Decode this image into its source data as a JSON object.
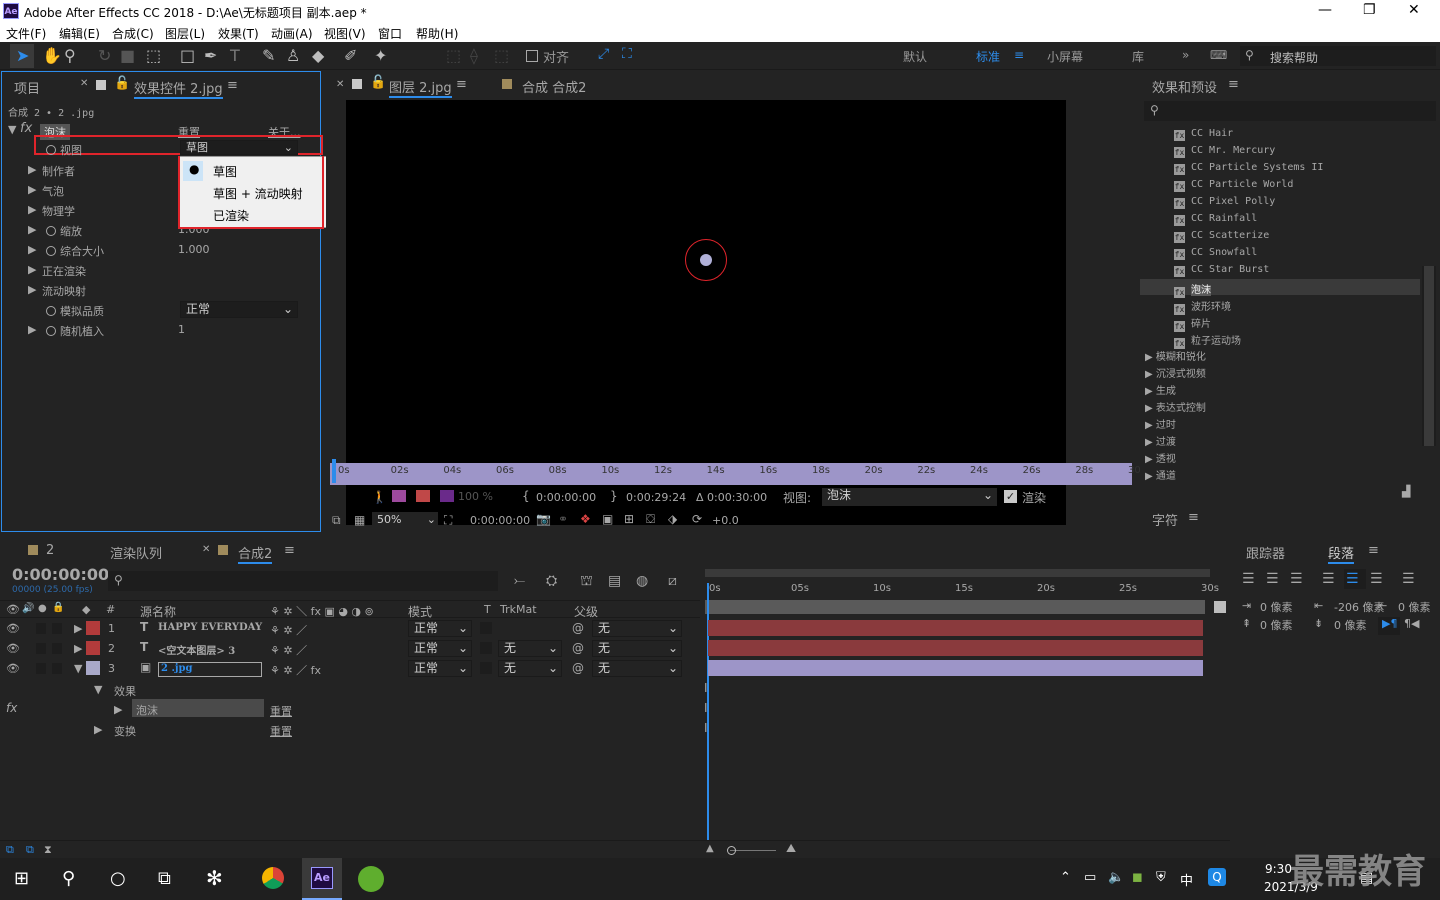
{
  "window": {
    "title": "Adobe After Effects CC 2018 - D:\\Ae\\无标题项目 副本.aep *",
    "logo": "Ae"
  },
  "menu": [
    "文件(F)",
    "编辑(E)",
    "合成(C)",
    "图层(L)",
    "效果(T)",
    "动画(A)",
    "视图(V)",
    "窗口",
    "帮助(H)"
  ],
  "toolbar": {
    "snap": "对齐",
    "workspaces": [
      "默认",
      "标准",
      "小屏幕",
      "库"
    ],
    "active_workspace": "标准",
    "search_placeholder": "搜索帮助"
  },
  "left_panel": {
    "tab_project": "项目",
    "tab_effects": "效果控件 2.jpg",
    "subtitle": "合成 2 • 2 .jpg",
    "effect_name": "泡沫",
    "reset": "重置",
    "about": "关于...",
    "props": [
      {
        "label": "视图",
        "value": "草图",
        "stopwatch": true
      },
      {
        "label": "制作者",
        "value": ""
      },
      {
        "label": "气泡",
        "value": ""
      },
      {
        "label": "物理学",
        "value": ""
      },
      {
        "label": "缩放",
        "value": "1.000",
        "stopwatch": true
      },
      {
        "label": "综合大小",
        "value": "1.000",
        "stopwatch": true
      },
      {
        "label": "正在渲染",
        "value": ""
      },
      {
        "label": "流动映射",
        "value": ""
      },
      {
        "label": "模拟品质",
        "value": "正常",
        "stopwatch": true
      },
      {
        "label": "随机植入",
        "value": "1",
        "stopwatch": true
      }
    ],
    "dropdown_options": [
      "草图",
      "草图 + 流动映射",
      "已渲染"
    ],
    "dropdown_selected": "草图"
  },
  "viewer": {
    "tab_layer": "图层 2.jpg",
    "tab_comp": "合成 合成2",
    "ruler": [
      "0s",
      "02s",
      "04s",
      "06s",
      "08s",
      "10s",
      "12s",
      "14s",
      "16s",
      "18s",
      "20s",
      "22s",
      "24s",
      "26s",
      "28s",
      "30s"
    ],
    "zoom_pct": "100 %",
    "in_time": "0:00:00:00",
    "out_time": "0:00:29:24",
    "duration": "Δ 0:00:30:00",
    "view_label": "视图:",
    "view_value": "泡沫",
    "render_label": "渲染",
    "mag": "50%",
    "current_time": "0:00:00:00",
    "exposure": "+0.0"
  },
  "effects_panel": {
    "title": "效果和预设",
    "search_placeholder": "",
    "items": [
      "CC Hair",
      "CC Mr. Mercury",
      "CC Particle Systems II",
      "CC Particle World",
      "CC Pixel Polly",
      "CC Rainfall",
      "CC Scatterize",
      "CC Snowfall",
      "CC Star Burst",
      "泡沫",
      "波形环境",
      "碎片",
      "粒子运动场"
    ],
    "selected": "泡沫",
    "categories": [
      "模糊和锐化",
      "沉浸式视频",
      "生成",
      "表达式控制",
      "过时",
      "过渡",
      "透视",
      "通道"
    ],
    "char_tab": "字符"
  },
  "timeline": {
    "tab2": "2",
    "tab_render": "渲染队列",
    "tab_comp": "合成2",
    "timecode": "0:00:00:00",
    "fps": "00000 (25.00 fps)",
    "col_source": "源名称",
    "col_mode": "模式",
    "col_t": "T",
    "col_trkmat": "TrkMat",
    "col_parent": "父级",
    "col_num": "#",
    "layers": [
      {
        "num": "1",
        "type": "T",
        "name": "HAPPY EVERYDAY",
        "mode": "正常",
        "trkmat": "",
        "parent": "无",
        "color": "#b23b3b"
      },
      {
        "num": "2",
        "type": "T",
        "name": "<空文本图层> 3",
        "mode": "正常",
        "trkmat": "无",
        "parent": "无",
        "color": "#b23b3b"
      },
      {
        "num": "3",
        "type": "img",
        "name": "2 .jpg",
        "mode": "正常",
        "trkmat": "无",
        "parent": "无",
        "color": "#a8a8c8"
      }
    ],
    "sub_effects": "效果",
    "sub_effect_name": "泡沫",
    "sub_reset": "重置",
    "sub_transform": "变换",
    "ruler": [
      "0s",
      "05s",
      "10s",
      "15s",
      "20s",
      "25s",
      "30s"
    ]
  },
  "right_bottom": {
    "tab_tracker": "跟踪器",
    "tab_paragraph": "段落",
    "indent1": "0 像素",
    "indent2": "-206 像素",
    "indent3": "0 像素",
    "space1": "0 像素",
    "space2": "0 像素"
  },
  "taskbar": {
    "time": "9:30",
    "date": "2021/3/9",
    "ime": "中"
  },
  "watermark": "最需教育"
}
